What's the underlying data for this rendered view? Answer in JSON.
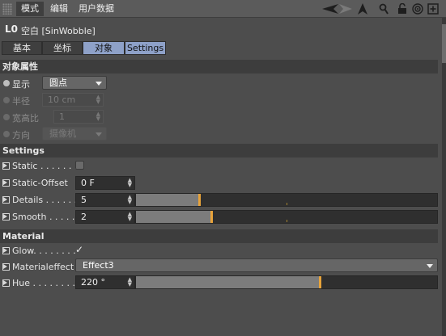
{
  "menubar": {
    "items": [
      {
        "label": "模式"
      },
      {
        "label": "编辑"
      },
      {
        "label": "用户数据"
      }
    ],
    "tools": [
      "back-arrow-icon",
      "forward-arrow-icon",
      "cursor-arrow-icon",
      "search-icon",
      "lock-icon",
      "target-icon",
      "new-window-icon"
    ]
  },
  "object": {
    "icon_glyph": "L0",
    "title": "空白 [SinWobble]"
  },
  "tabs": [
    {
      "label": "基本",
      "active": false
    },
    {
      "label": "坐标",
      "active": false
    },
    {
      "label": "对象",
      "active": true
    },
    {
      "label": "Settings",
      "active": true
    }
  ],
  "sections": {
    "object_props": "对象属性",
    "settings": "Settings",
    "material": "Material"
  },
  "object_props": {
    "display": {
      "label": "显示",
      "value": "圆点"
    },
    "radius": {
      "label": "半径",
      "value": "10 cm"
    },
    "aspect": {
      "label": "宽高比",
      "value": "1"
    },
    "orientation": {
      "label": "方向",
      "value": "摄像机"
    }
  },
  "settings": {
    "static": {
      "label": "Static . . . . . . ."
    },
    "static_offset": {
      "label": "Static-Offset",
      "value": "0 F"
    },
    "details": {
      "label": "Details . . . . . .",
      "value": "5",
      "fill": 0.21
    },
    "smooth": {
      "label": "Smooth . . . . .",
      "value": "2",
      "fill": 0.25
    }
  },
  "material": {
    "glow": {
      "label": "Glow. . . . . . . .",
      "checked": true,
      "check_glyph": "✓"
    },
    "materialeffect": {
      "label": "Materialeffect",
      "value": "Effect3"
    },
    "hue": {
      "label": "Hue . . . . . . . .",
      "value": "220 °",
      "fill": 0.61
    }
  },
  "colors": {
    "accent_tab": "#8ea1c8",
    "slider_knob": "#e8a33a"
  }
}
